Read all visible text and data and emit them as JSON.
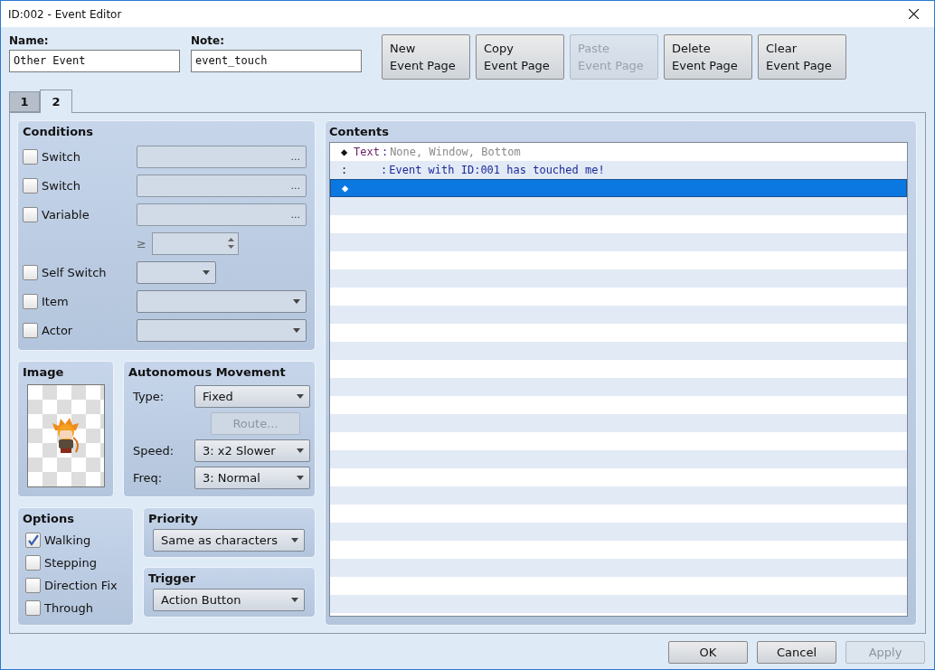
{
  "window": {
    "title": "ID:002 - Event Editor"
  },
  "fields": [
    {
      "label": "Name:",
      "value": "Other Event"
    },
    {
      "label": "Note:",
      "value": "event_touch"
    }
  ],
  "page_buttons": [
    {
      "line1": "New",
      "line2": "Event Page",
      "disabled": false
    },
    {
      "line1": "Copy",
      "line2": "Event Page",
      "disabled": false
    },
    {
      "line1": "Paste",
      "line2": "Event Page",
      "disabled": true
    },
    {
      "line1": "Delete",
      "line2": "Event Page",
      "disabled": false
    },
    {
      "line1": "Clear",
      "line2": "Event Page",
      "disabled": false
    }
  ],
  "tabs": [
    {
      "label": "1",
      "selected": false
    },
    {
      "label": "2",
      "selected": true
    }
  ],
  "conditions": {
    "title": "Conditions",
    "rows": [
      {
        "kind": "picker",
        "label": "Switch",
        "checked": false,
        "button": "..."
      },
      {
        "kind": "picker",
        "label": "Switch",
        "checked": false,
        "button": "..."
      },
      {
        "kind": "picker",
        "label": "Variable",
        "checked": false,
        "button": "..."
      },
      {
        "kind": "compare",
        "symbol": "≥"
      },
      {
        "kind": "short-dropdown",
        "label": "Self Switch",
        "checked": false
      },
      {
        "kind": "dropdown",
        "label": "Item",
        "checked": false
      },
      {
        "kind": "dropdown",
        "label": "Actor",
        "checked": false
      }
    ]
  },
  "image": {
    "title": "Image"
  },
  "movement": {
    "title": "Autonomous Movement",
    "rows": [
      {
        "kind": "dropdown",
        "label": "Type:",
        "value": "Fixed"
      },
      {
        "kind": "button",
        "value": "Route...",
        "disabled": true
      },
      {
        "kind": "dropdown",
        "label": "Speed:",
        "value": "3: x2 Slower"
      },
      {
        "kind": "dropdown",
        "label": "Freq:",
        "value": "3: Normal"
      }
    ]
  },
  "options": {
    "title": "Options",
    "items": [
      {
        "label": "Walking",
        "checked": true
      },
      {
        "label": "Stepping",
        "checked": false
      },
      {
        "label": "Direction Fix",
        "checked": false
      },
      {
        "label": "Through",
        "checked": false
      }
    ]
  },
  "priority": {
    "title": "Priority",
    "value": "Same as characters"
  },
  "trigger": {
    "title": "Trigger",
    "value": "Action Button"
  },
  "contents": {
    "title": "Contents",
    "lines": [
      {
        "marker": "◆",
        "command": "Text",
        "separator": ":",
        "args": "None, Window, Bottom",
        "selected": false
      },
      {
        "marker": ":",
        "separator": ":",
        "args": "Event with ID:001 has touched me!",
        "selected": false
      },
      {
        "marker": "◆",
        "selected": true
      }
    ]
  },
  "footer": [
    {
      "label": "OK",
      "disabled": false
    },
    {
      "label": "Cancel",
      "disabled": false
    },
    {
      "label": "Apply",
      "disabled": true
    }
  ]
}
